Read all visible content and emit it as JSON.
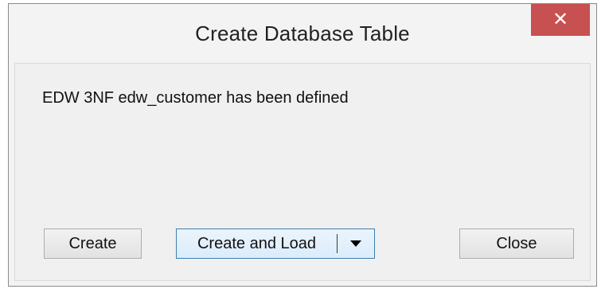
{
  "window": {
    "title": "Create Database Table",
    "close_glyph": "✕"
  },
  "message": "EDW 3NF edw_customer has been defined",
  "buttons": {
    "create": "Create",
    "create_and_load": "Create and Load",
    "dropdown_icon": "triangle-down-icon",
    "close": "Close"
  },
  "colors": {
    "close_button_bg": "#c75050",
    "primary_button_border": "#3c7fb1"
  }
}
